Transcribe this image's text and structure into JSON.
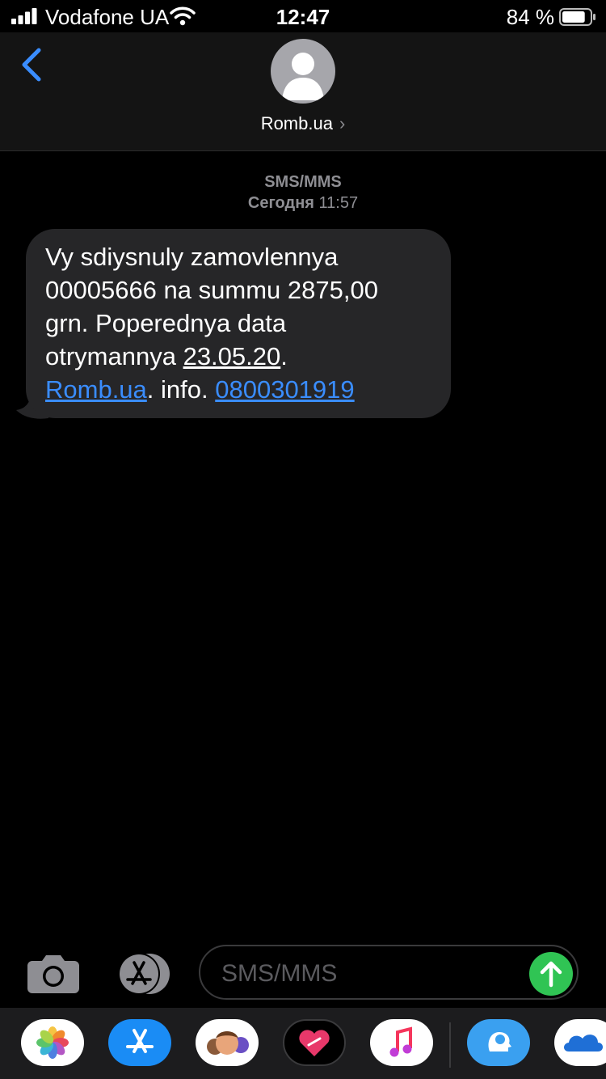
{
  "status_bar": {
    "carrier": "Vodafone UA",
    "time": "12:47",
    "battery_percent": "84 %",
    "battery_level": 0.84
  },
  "header": {
    "contact_name": "Romb.ua",
    "chevron": "›"
  },
  "thread": {
    "service_label": "SMS/MMS",
    "day": "Сегодня",
    "time": "11:57",
    "message": {
      "line1": "Vy sdiysnuly zamovlennya",
      "line2": "00005666 na summu 2875,00",
      "line3": "grn. Poperednya data",
      "line4_prefix": "otrymannya ",
      "date": "23.05.20",
      "line4_suffix": ".",
      "link_site": "Romb.ua",
      "mid_text": ". info. ",
      "phone": "0800301919"
    }
  },
  "composer": {
    "placeholder": "SMS/MMS"
  },
  "colors": {
    "accent": "#3a8dff",
    "send": "#30c454",
    "bubble": "#262628"
  },
  "app_drawer": [
    "photos-icon",
    "app-store-icon",
    "memoji-icon",
    "digital-touch-icon",
    "music-icon",
    "brain-app-icon",
    "onedrive-icon"
  ]
}
